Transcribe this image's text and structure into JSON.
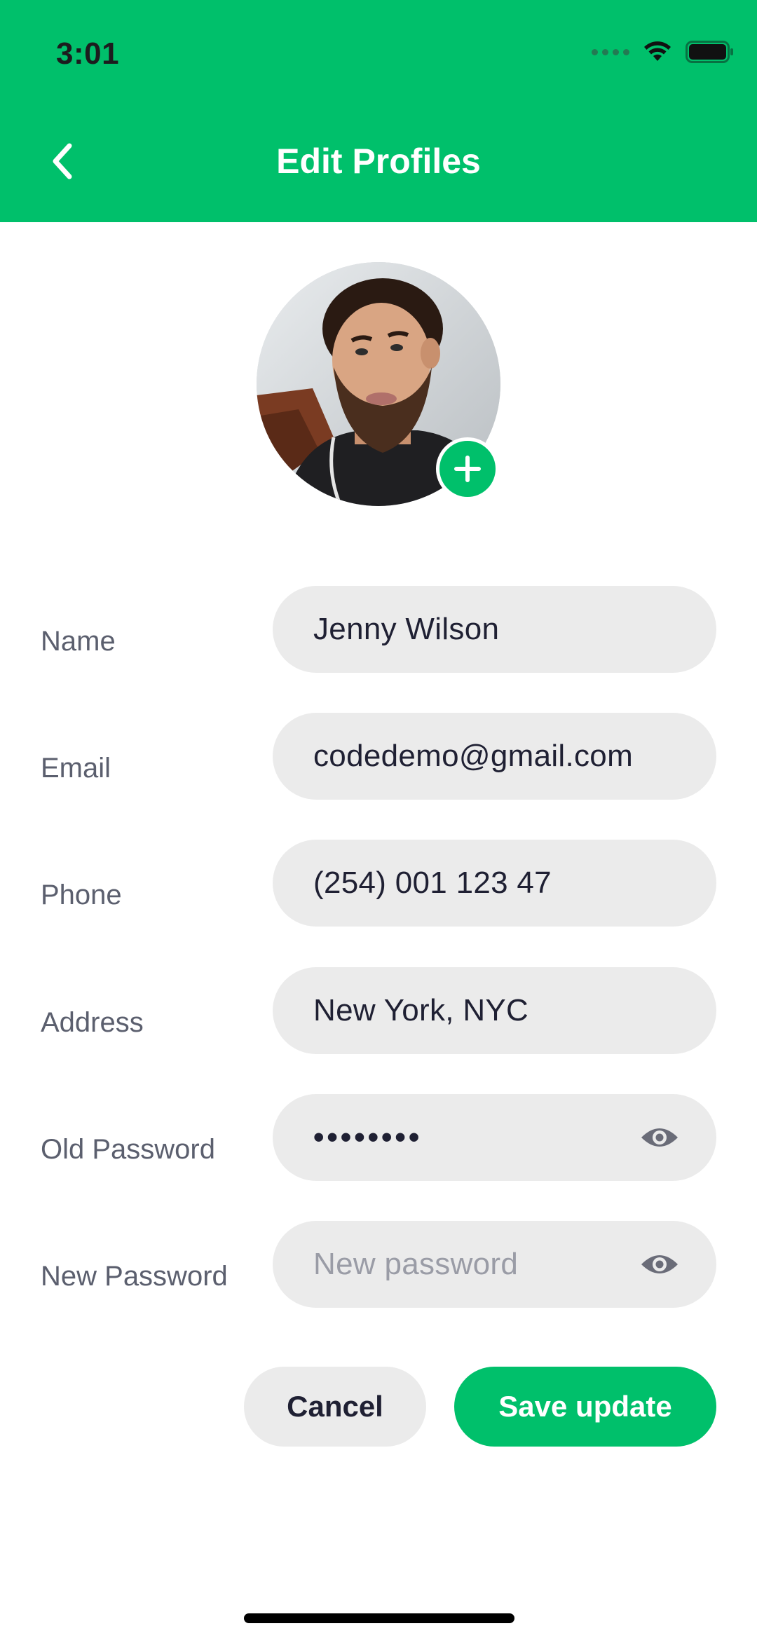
{
  "status_bar": {
    "time": "3:01",
    "icons": [
      "signal-icon",
      "wifi-icon",
      "battery-icon"
    ]
  },
  "header": {
    "title": "Edit Profiles",
    "back_icon": "chevron-left-icon",
    "background_color": "#00c06b"
  },
  "profile": {
    "avatar_icon": "avatar",
    "add_photo_icon": "plus-icon"
  },
  "form": {
    "name": {
      "label": "Name",
      "value": "Jenny Wilson"
    },
    "email": {
      "label": "Email",
      "value": "codedemo@gmail.com"
    },
    "phone": {
      "label": "Phone",
      "value": "(254) 001 123 47"
    },
    "address": {
      "label": "Address",
      "value": "New York, NYC"
    },
    "old_password": {
      "label": "Old Password",
      "masked_value": "••••••••"
    },
    "new_password": {
      "label": "New Password",
      "placeholder": "New password"
    }
  },
  "actions": {
    "cancel_label": "Cancel",
    "save_label": "Save update"
  },
  "colors": {
    "accent": "#00c06b",
    "field_background": "#ebebeb",
    "label_text": "#5b5f6e",
    "value_text": "#1f2033"
  }
}
